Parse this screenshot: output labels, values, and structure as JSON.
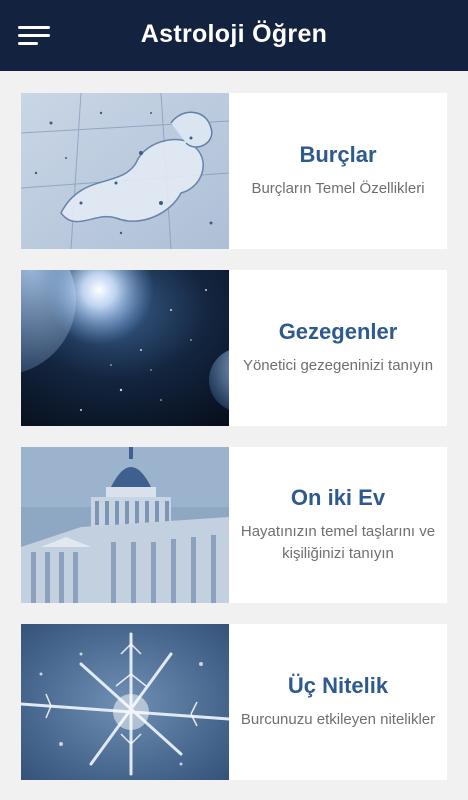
{
  "header": {
    "title": "Astroloji Öğren",
    "menu_icon": "hamburger-menu-icon",
    "background_color": "#13233f"
  },
  "cards": [
    {
      "title": "Burçlar",
      "subtitle": "Burçların Temel Özellikleri",
      "image": "zodiac-constellation-chart"
    },
    {
      "title": "Gezegenler",
      "subtitle": "Yönetici gezegeninizi tanıyın",
      "image": "planets-in-space"
    },
    {
      "title": "On iki Ev",
      "subtitle": "Hayatınızın temel taşlarını ve kişiliğinizi tanıyın",
      "image": "domed-capitol-building"
    },
    {
      "title": "Üç Nitelik",
      "subtitle": "Burcunuzu etkileyen nitelikler",
      "image": "ice-crystals"
    }
  ],
  "colors": {
    "card_title": "#2f5a8f",
    "card_subtitle": "#6f6f6f",
    "page_background": "#f1f1f1"
  }
}
